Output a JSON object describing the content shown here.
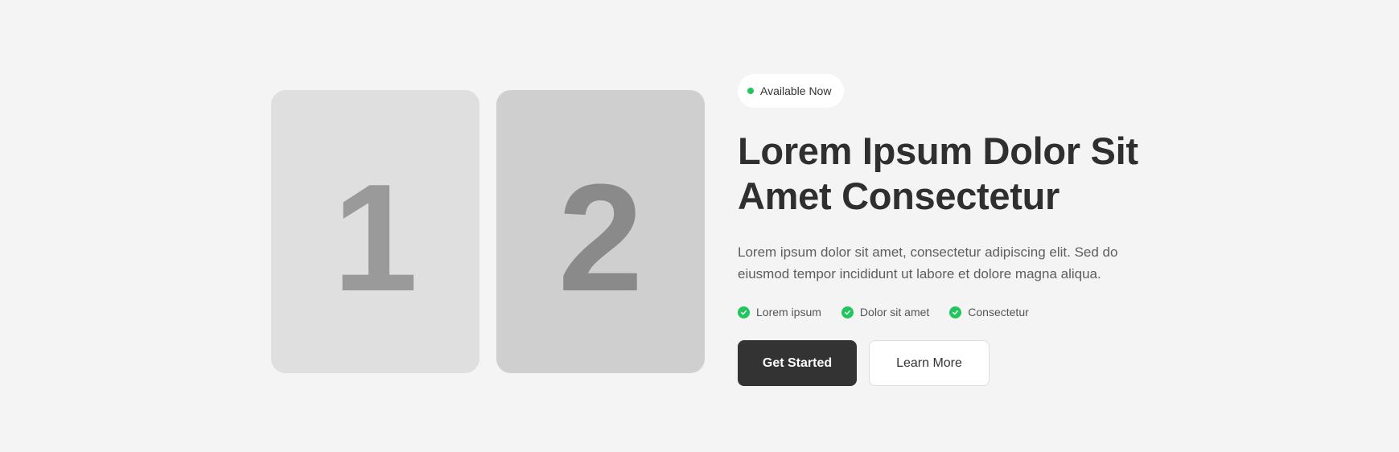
{
  "cards": [
    {
      "label": "1"
    },
    {
      "label": "2"
    }
  ],
  "badge": {
    "text": "Available Now",
    "dot_color": "#22c55e"
  },
  "hero": {
    "title_line_1": "Lorem Ipsum Dolor Sit",
    "title_line_2": "Amet Consectetur",
    "description": "Lorem ipsum dolor sit amet, consectetur adipiscing elit. Sed do eiusmod tempor incididunt ut labore et dolore magna aliqua."
  },
  "features": [
    {
      "label": "Lorem ipsum",
      "icon": "check-circle-icon"
    },
    {
      "label": "Dolor sit amet",
      "icon": "check-circle-icon"
    },
    {
      "label": "Consectetur",
      "icon": "check-circle-icon"
    }
  ],
  "actions": {
    "primary_label": "Get Started",
    "secondary_label": "Learn More"
  },
  "colors": {
    "background": "#f4f4f4",
    "accent_green": "#22c55e",
    "primary_button": "#333333"
  }
}
